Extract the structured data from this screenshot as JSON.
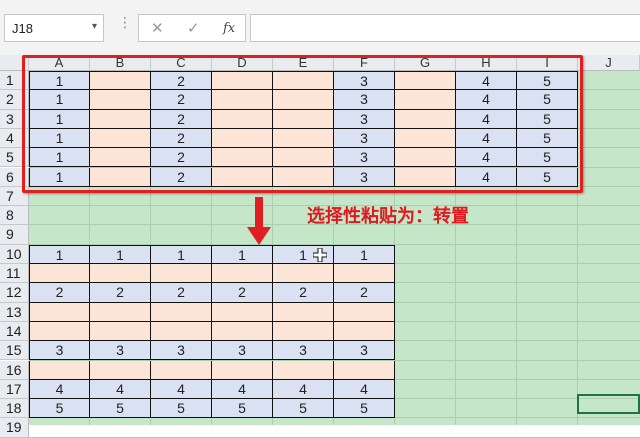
{
  "formula_bar": {
    "name_box": "J18",
    "name_box_dropdown": "▾",
    "separator": "⋮",
    "cancel_glyph": "✕",
    "confirm_glyph": "✓",
    "fx_glyph": "fx",
    "formula": ""
  },
  "columns": [
    "A",
    "B",
    "C",
    "D",
    "E",
    "F",
    "G",
    "H",
    "I",
    "J"
  ],
  "rows": [
    "1",
    "2",
    "3",
    "4",
    "5",
    "6",
    "7",
    "8",
    "9",
    "10",
    "11",
    "12",
    "13",
    "14",
    "15",
    "16",
    "17",
    "18",
    "19"
  ],
  "source_table": {
    "row_values": [
      "1",
      "",
      "2",
      "",
      "",
      "3",
      "",
      "4",
      "5"
    ],
    "row_fills": [
      "blue",
      "peach",
      "blue",
      "peach",
      "peach",
      "blue",
      "peach",
      "blue",
      "blue"
    ],
    "row_count": 6
  },
  "transposed_table": {
    "rows": [
      {
        "fill": "blue",
        "values": [
          "1",
          "1",
          "1",
          "1",
          "1",
          "1"
        ]
      },
      {
        "fill": "peach",
        "values": [
          "",
          "",
          "",
          "",
          "",
          ""
        ]
      },
      {
        "fill": "blue",
        "values": [
          "2",
          "2",
          "2",
          "2",
          "2",
          "2"
        ]
      },
      {
        "fill": "peach",
        "values": [
          "",
          "",
          "",
          "",
          "",
          ""
        ]
      },
      {
        "fill": "peach",
        "values": [
          "",
          "",
          "",
          "",
          "",
          ""
        ]
      },
      {
        "fill": "blue",
        "values": [
          "3",
          "3",
          "3",
          "3",
          "3",
          "3"
        ]
      },
      {
        "fill": "peach",
        "values": [
          "",
          "",
          "",
          "",
          "",
          ""
        ]
      },
      {
        "fill": "blue",
        "values": [
          "4",
          "4",
          "4",
          "4",
          "4",
          "4"
        ]
      },
      {
        "fill": "blue",
        "values": [
          "5",
          "5",
          "5",
          "5",
          "5",
          "5"
        ]
      }
    ]
  },
  "annotation": "选择性粘贴为：转置",
  "colors": {
    "accent_red": "#e02020",
    "sheet_green": "#c6e6c9",
    "fill_blue": "#d9e1f2",
    "fill_peach": "#fce4d6",
    "select_green": "#217346"
  }
}
